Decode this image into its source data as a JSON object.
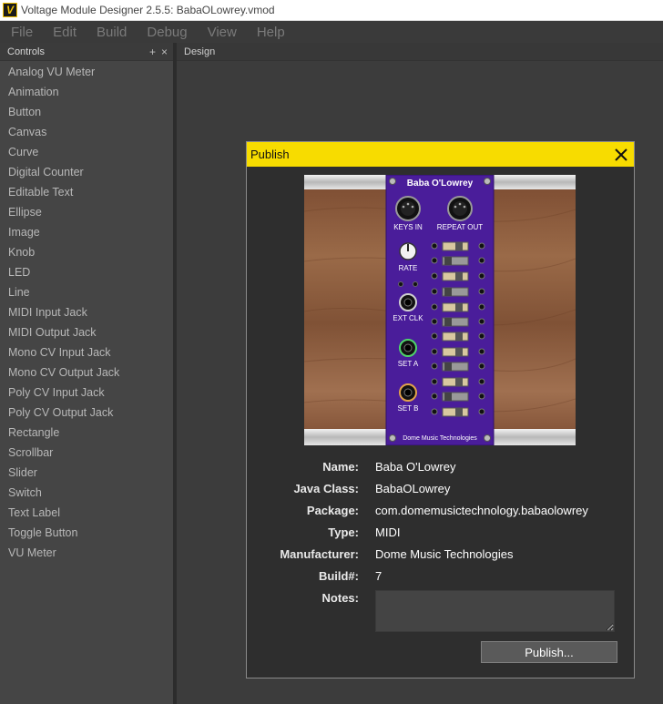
{
  "window": {
    "title": "Voltage Module Designer 2.5.5: BabaOLowrey.vmod"
  },
  "menu": [
    "File",
    "Edit",
    "Build",
    "Debug",
    "View",
    "Help"
  ],
  "controls_panel": {
    "title": "Controls",
    "add_glyph": "+",
    "close_glyph": "×",
    "items": [
      "Analog VU Meter",
      "Animation",
      "Button",
      "Canvas",
      "Curve",
      "Digital Counter",
      "Editable Text",
      "Ellipse",
      "Image",
      "Knob",
      "LED",
      "Line",
      "MIDI Input Jack",
      "MIDI Output Jack",
      "Mono CV Input Jack",
      "Mono CV Output Jack",
      "Poly CV Input Jack",
      "Poly CV Output Jack",
      "Rectangle",
      "Scrollbar",
      "Slider",
      "Switch",
      "Text Label",
      "Toggle Button",
      "VU Meter"
    ]
  },
  "design": {
    "title": "Design"
  },
  "dialog": {
    "title": "Publish",
    "module_preview": {
      "title": "Baba O'Lowrey",
      "labels": {
        "keys_in": "KEYS IN",
        "repeat_out": "REPEAT OUT",
        "rate": "RATE",
        "ext_clk": "EXT CLK",
        "set_a": "SET A",
        "set_b": "SET B"
      },
      "footer": "Dome Music Technologies",
      "colors": {
        "panel": "#4a1d9a",
        "wood": "#8b5a3a",
        "rail": "#d8d8d8"
      }
    },
    "fields": [
      {
        "label": "Name:",
        "value": "Baba O'Lowrey"
      },
      {
        "label": "Java Class:",
        "value": "BabaOLowrey"
      },
      {
        "label": "Package:",
        "value": "com.domemusictechnology.babaolowrey"
      },
      {
        "label": "Type:",
        "value": "MIDI"
      },
      {
        "label": "Manufacturer:",
        "value": "Dome Music Technologies"
      },
      {
        "label": "Build#:",
        "value": "7"
      }
    ],
    "notes": {
      "label": "Notes:",
      "value": ""
    },
    "publish_button": "Publish..."
  }
}
